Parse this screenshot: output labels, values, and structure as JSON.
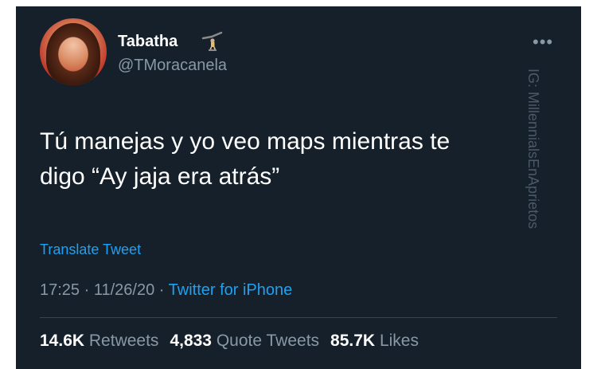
{
  "tweet": {
    "author_name": "Tabatha",
    "handle": "@TMoracanela",
    "text_line1": "Tú manejas y yo veo maps mientras te",
    "text_line2": "digo “Ay jaja era atrás”",
    "translate_label": "Translate Tweet",
    "time": "17:25",
    "date": "11/26/20",
    "separator": " · ",
    "source": "Twitter for iPhone",
    "more_icon": "more-icon"
  },
  "stats": {
    "retweets_count": "14.6K",
    "retweets_label": "Retweets",
    "quotes_count": "4,833",
    "quotes_label": "Quote Tweets",
    "likes_count": "85.7K",
    "likes_label": "Likes"
  },
  "watermark": "IG: MillennialsEnAprietos",
  "colors": {
    "background": "#15202b",
    "text": "#ffffff",
    "secondary": "#8899a6",
    "link": "#1da1f2"
  }
}
